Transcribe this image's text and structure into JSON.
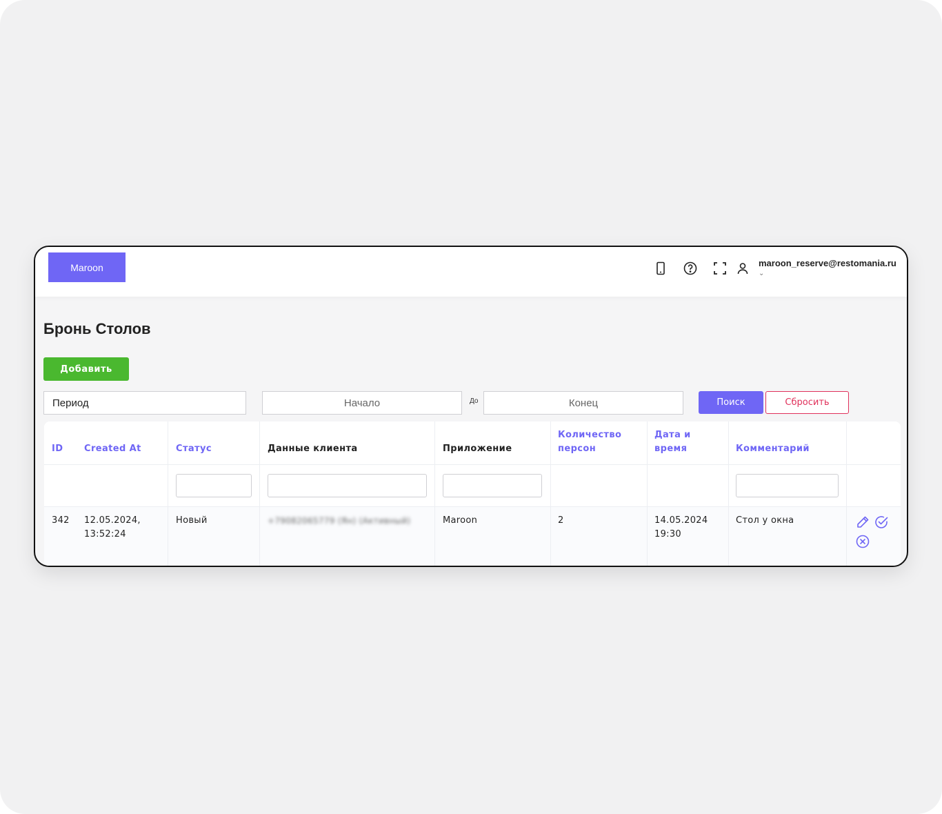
{
  "header": {
    "brand": "Maroon",
    "user_email": "maroon_reserve@restomania.ru",
    "user_caret": "⌄",
    "icons": [
      "mobile-icon",
      "help-icon",
      "fullscreen-icon",
      "user-icon"
    ]
  },
  "page": {
    "title": "Бронь Столов",
    "add_button": "Добавить"
  },
  "filters": {
    "period_value": "Период",
    "start_placeholder": "Начало",
    "to_label": "До",
    "end_placeholder": "Конец",
    "search_button": "Поиск",
    "reset_button": "Сбросить"
  },
  "table": {
    "headers": {
      "id": "ID",
      "created_at": "Created At",
      "status": "Статус",
      "client": "Данные клиента",
      "app": "Приложение",
      "persons_1": "Количество",
      "persons_2": "персон",
      "datetime_1": "Дата и",
      "datetime_2": "время",
      "comment": "Комментарий"
    },
    "rows": [
      {
        "id": "342",
        "created_1": "12.05.2024,",
        "created_2": "13:52:24",
        "status": "Новый",
        "client": "+79082065779 (Ян) (Активный)",
        "app": "Maroon",
        "persons": "2",
        "date": "14.05.2024",
        "time": "19:30",
        "comment": "Стол у окна",
        "actions": [
          "edit-icon",
          "confirm-icon",
          "cancel-icon"
        ]
      }
    ]
  },
  "colors": {
    "accent": "#6f66f5",
    "add_green": "#4ab82f",
    "reset_red": "#e0305a"
  }
}
